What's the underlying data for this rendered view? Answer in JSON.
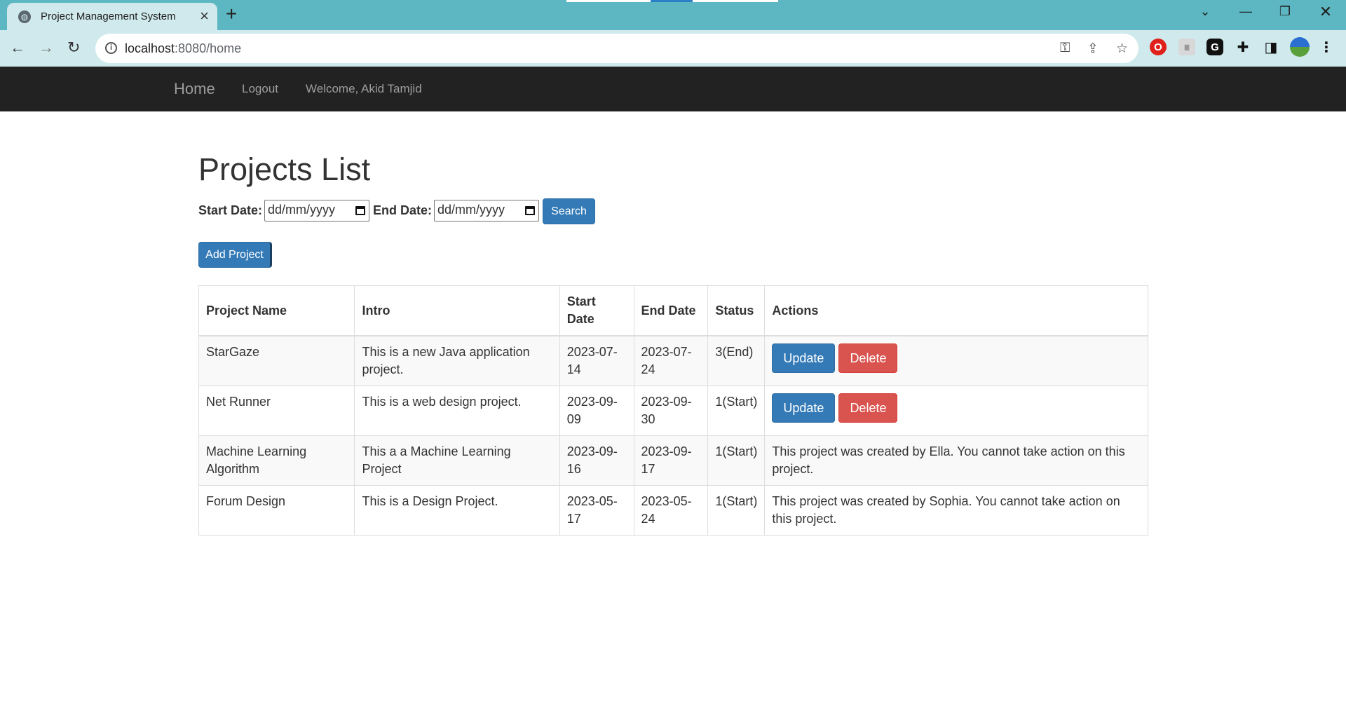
{
  "browser": {
    "tab_title": "Project Management System",
    "url_host": "localhost",
    "url_path": ":8080/home"
  },
  "navbar": {
    "brand": "Home",
    "logout": "Logout",
    "welcome": "Welcome, Akid Tamjid"
  },
  "page": {
    "title": "Projects List",
    "start_label": "Start Date:",
    "end_label": "End Date:",
    "date_placeholder": "dd/mm/yyyy",
    "search_button": "Search",
    "add_button": "Add Project"
  },
  "table": {
    "headers": [
      "Project Name",
      "Intro",
      "Start Date",
      "End Date",
      "Status",
      "Actions"
    ],
    "rows": [
      {
        "name": "StarGaze",
        "intro": "This is a new Java application project.",
        "start": "2023-07-14",
        "end": "2023-07-24",
        "status": "3(End)",
        "update": "Update",
        "delete": "Delete",
        "message": ""
      },
      {
        "name": "Net Runner",
        "intro": "This is a web design project.",
        "start": "2023-09-09",
        "end": "2023-09-30",
        "status": "1(Start)",
        "update": "Update",
        "delete": "Delete",
        "message": ""
      },
      {
        "name": "Machine Learning Algorithm",
        "intro": "This a a Machine Learning Project",
        "start": "2023-09-16",
        "end": "2023-09-17",
        "status": "1(Start)",
        "update": "",
        "delete": "",
        "message": "This project was created by Ella. You cannot take action on this project."
      },
      {
        "name": "Forum Design",
        "intro": "This is a Design Project.",
        "start": "2023-05-17",
        "end": "2023-05-24",
        "status": "1(Start)",
        "update": "",
        "delete": "",
        "message": "This project was created by Sophia. You cannot take action on this project."
      }
    ]
  },
  "colors": {
    "tabbar": "#5db7c2",
    "toolbar": "#cfe9ec",
    "navbar": "#222222",
    "primary": "#337ab7",
    "danger": "#d9534f"
  }
}
